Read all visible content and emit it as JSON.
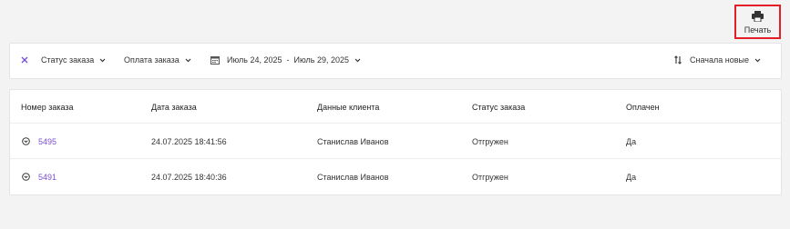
{
  "toolbar": {
    "print_label": "Печать"
  },
  "filters": {
    "order_status_label": "Статус заказа",
    "payment_label": "Оплата заказа",
    "date_range_label": "Июль 24, 2025  -  Июль 29, 2025",
    "sort_label": "Сначала новые"
  },
  "table": {
    "headers": [
      "Номер заказа",
      "Дата заказа",
      "Данные клиента",
      "Статус заказа",
      "Оплачен"
    ],
    "rows": [
      {
        "order_number": "5495",
        "date": "24.07.2025 18:41:56",
        "client": "Станислав Иванов",
        "status": "Отгружен",
        "paid": "Да"
      },
      {
        "order_number": "5491",
        "date": "24.07.2025 18:40:36",
        "client": "Станислав Иванов",
        "status": "Отгружен",
        "paid": "Да"
      }
    ]
  },
  "colors": {
    "accent": "#7b4fd6",
    "highlight_border": "#e41e26"
  }
}
